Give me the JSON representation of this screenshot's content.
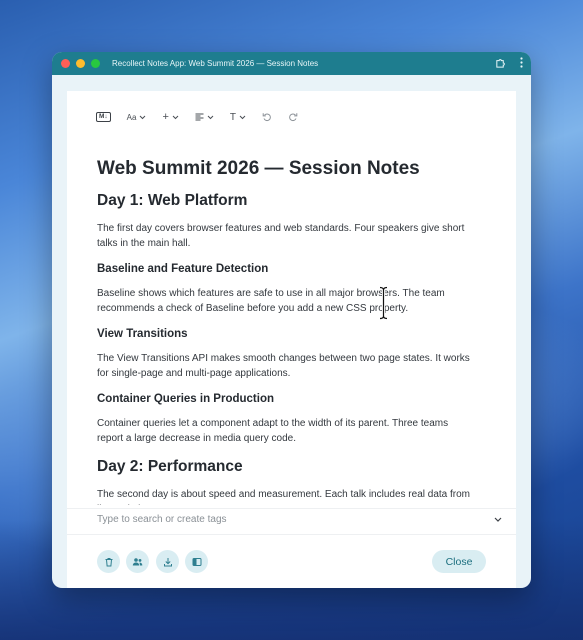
{
  "window": {
    "title": "Recollect Notes App: Web Summit 2026 — Session Notes"
  },
  "toolbar": {
    "markdown_badge": "M↓",
    "font_label": "Aa",
    "insert_label": "+",
    "align_icon": "align-left-icon",
    "text_style_label": "T",
    "undo_icon": "undo-icon",
    "redo_icon": "redo-icon"
  },
  "note": {
    "title": "Web Summit 2026 — Session Notes",
    "day1_heading": "Day 1: Web Platform",
    "day1_intro": "The first day covers browser features and web standards. Four speakers give short talks in the main hall.",
    "s1_heading": "Baseline and Feature Detection",
    "s1_body": "Baseline shows which features are safe to use in all major browsers. The team recommends a check of Baseline before you add a new CSS property.",
    "s2_heading": "View Transitions",
    "s2_body": "The View Transitions API makes smooth changes between two page states. It works for single-page and multi-page applications.",
    "s3_heading": "Container Queries in Production",
    "s3_body": "Container queries let a component adapt to the width of its parent. Three teams report a large decrease in media query code.",
    "day2_heading": "Day 2: Performance",
    "day2_intro": "The second day is about speed and measurement. Each talk includes real data from live websites."
  },
  "tags": {
    "placeholder": "Type to search or create tags"
  },
  "footer": {
    "delete_icon": "trash-icon",
    "share_icon": "people-icon",
    "download_icon": "download-icon",
    "sidebar_icon": "panel-icon",
    "close_label": "Close"
  },
  "colors": {
    "titlebar": "#1e7d8f",
    "accent": "#1c6f7f",
    "button_bg": "#d9edf2"
  }
}
